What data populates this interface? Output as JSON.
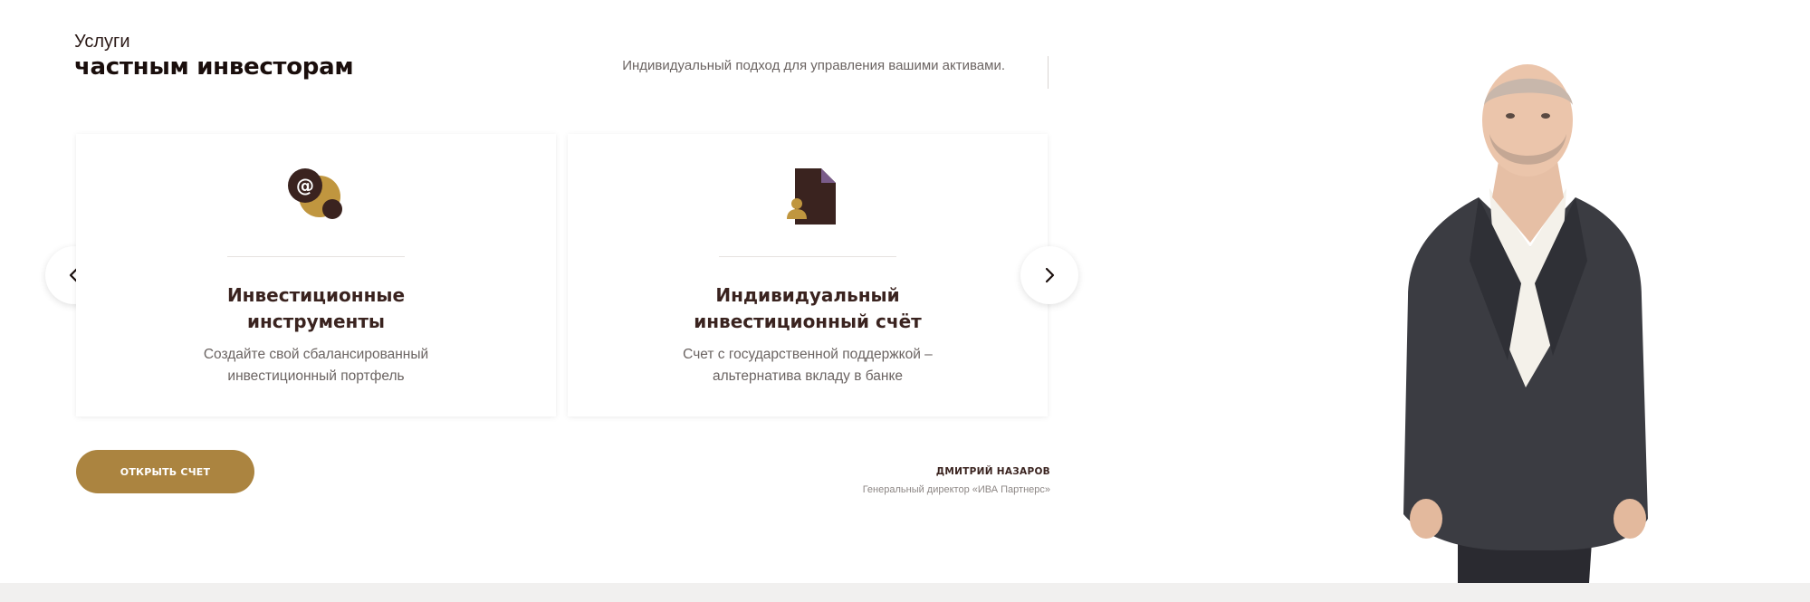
{
  "section": {
    "title_small": "Услуги",
    "title_big": "частным инвесторам",
    "subtitle": "Индивидуальный подход для управления вашими активами."
  },
  "cards": [
    {
      "icon": "email-at-icon",
      "title": "Инвестиционные инструменты",
      "description": "Создайте свой сбалансированный инвестиционный портфель"
    },
    {
      "icon": "document-person-icon",
      "title": "Индивидуальный инвестиционный счёт",
      "description": "Счет с государственной поддержкой – альтернатива вкладу в банке"
    }
  ],
  "carousel": {
    "prev_icon": "chevron-left-icon",
    "next_icon": "chevron-right-icon"
  },
  "cta": {
    "label": "ОТКРЫТЬ СЧЕТ"
  },
  "person": {
    "name": "ДМИТРИЙ НАЗАРОВ",
    "role": "Генеральный директор «ИВА Партнерс»"
  },
  "colors": {
    "accent": "#ab8440",
    "dark_brown": "#3a231f",
    "text_muted": "#6b6462",
    "footer_bg": "#f1f0ef"
  }
}
